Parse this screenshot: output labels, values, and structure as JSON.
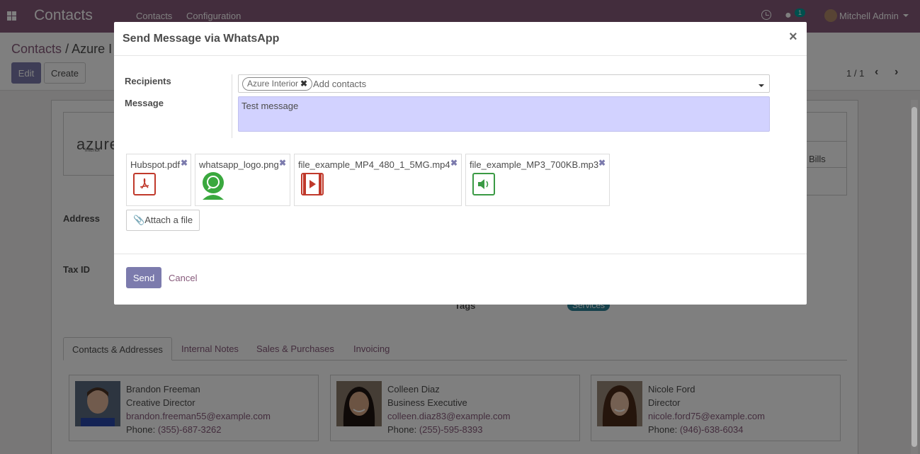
{
  "navbar": {
    "app_title": "Contacts",
    "menu": [
      "Contacts",
      "Configuration"
    ],
    "chat_badge": "1",
    "user_name": "Mitchell Admin"
  },
  "control_panel": {
    "breadcrumb_root": "Contacts",
    "breadcrumb_sep": "/",
    "breadcrumb_current": "Azure I",
    "edit_label": "Edit",
    "create_label": "Create",
    "pager_value": "1 / 1"
  },
  "form": {
    "logo_text": "azure",
    "logo_sub": "interior",
    "stat_text": "r Bills",
    "address_label": "Address",
    "tax_label": "Tax ID",
    "tags_label": "Tags",
    "tag": "Services",
    "tabs": [
      "Contacts & Addresses",
      "Internal Notes",
      "Sales & Purchases",
      "Invoicing"
    ],
    "contacts": [
      {
        "name": "Brandon Freeman",
        "title": "Creative Director",
        "email": "brandon.freeman55@example.com",
        "phone_label": "Phone:",
        "phone": "(355)-687-3262"
      },
      {
        "name": "Colleen Diaz",
        "title": "Business Executive",
        "email": "colleen.diaz83@example.com",
        "phone_label": "Phone:",
        "phone": "(255)-595-8393"
      },
      {
        "name": "Nicole Ford",
        "title": "Director",
        "email": "nicole.ford75@example.com",
        "phone_label": "Phone:",
        "phone": "(946)-638-6034"
      }
    ]
  },
  "modal": {
    "title": "Send Message via WhatsApp",
    "close_glyph": "×",
    "recipients_label": "Recipients",
    "recipient_chip": "Azure Interior",
    "recipients_placeholder": "Add contacts",
    "message_label": "Message",
    "message_value": "Test message",
    "attachments": [
      {
        "name": "Hubspot.pdf",
        "icon": "pdf-icon",
        "color": "#c0392b"
      },
      {
        "name": "whatsapp_logo.png",
        "icon": "whatsapp-icon",
        "color": "#3aa83e"
      },
      {
        "name": "file_example_MP4_480_1_5MG.mp4",
        "icon": "video-file-icon",
        "color": "#c0392b"
      },
      {
        "name": "file_example_MP3_700KB.mp3",
        "icon": "audio-file-icon",
        "color": "#3a9a44"
      }
    ],
    "attach_label": "Attach a file",
    "send_label": "Send",
    "cancel_label": "Cancel"
  },
  "colors": {
    "brand": "#875a7b",
    "primary_button": "#7c7bad",
    "message_bg": "#d2d2ff",
    "tag": "#2c8397"
  }
}
